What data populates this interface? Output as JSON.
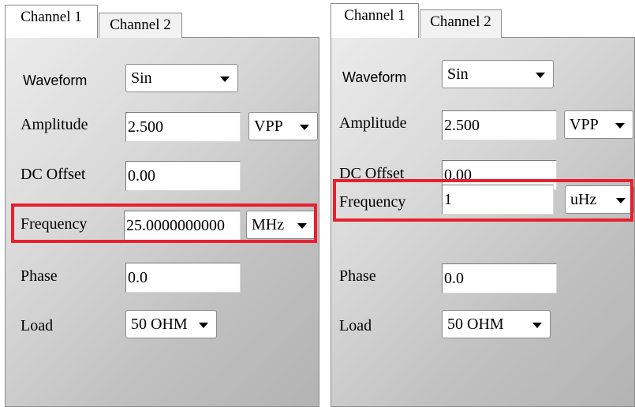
{
  "panels": [
    {
      "tabs": [
        "Channel 1",
        "Channel 2"
      ],
      "fields": {
        "waveform": {
          "label": "Waveform",
          "value": "Sin"
        },
        "amplitude": {
          "label": "Amplitude",
          "value": "2.500",
          "unit": "VPP"
        },
        "dc_offset": {
          "label": "DC Offset",
          "value": "0.00"
        },
        "frequency": {
          "label": "Frequency",
          "value": "25.0000000000",
          "unit": "MHz"
        },
        "phase": {
          "label": "Phase",
          "value": "0.0"
        },
        "load": {
          "label": "Load",
          "value": "50 OHM"
        }
      }
    },
    {
      "tabs": [
        "Channel 1",
        "Channel 2"
      ],
      "fields": {
        "waveform": {
          "label": "Waveform",
          "value": "Sin"
        },
        "amplitude": {
          "label": "Amplitude",
          "value": "2.500",
          "unit": "VPP"
        },
        "dc_offset": {
          "label": "DC Offset",
          "value": "0.00"
        },
        "frequency": {
          "label": "Frequency",
          "value": "1",
          "unit": "uHz"
        },
        "phase": {
          "label": "Phase",
          "value": "0.0"
        },
        "load": {
          "label": "Load",
          "value": "50 OHM"
        }
      }
    }
  ],
  "colors": {
    "highlight": "#e8202e",
    "panel_gradient_light": "#ebebeb",
    "panel_gradient_dark": "#b3b3b3"
  },
  "icons": {
    "dropdown": "chevron-down-icon"
  }
}
